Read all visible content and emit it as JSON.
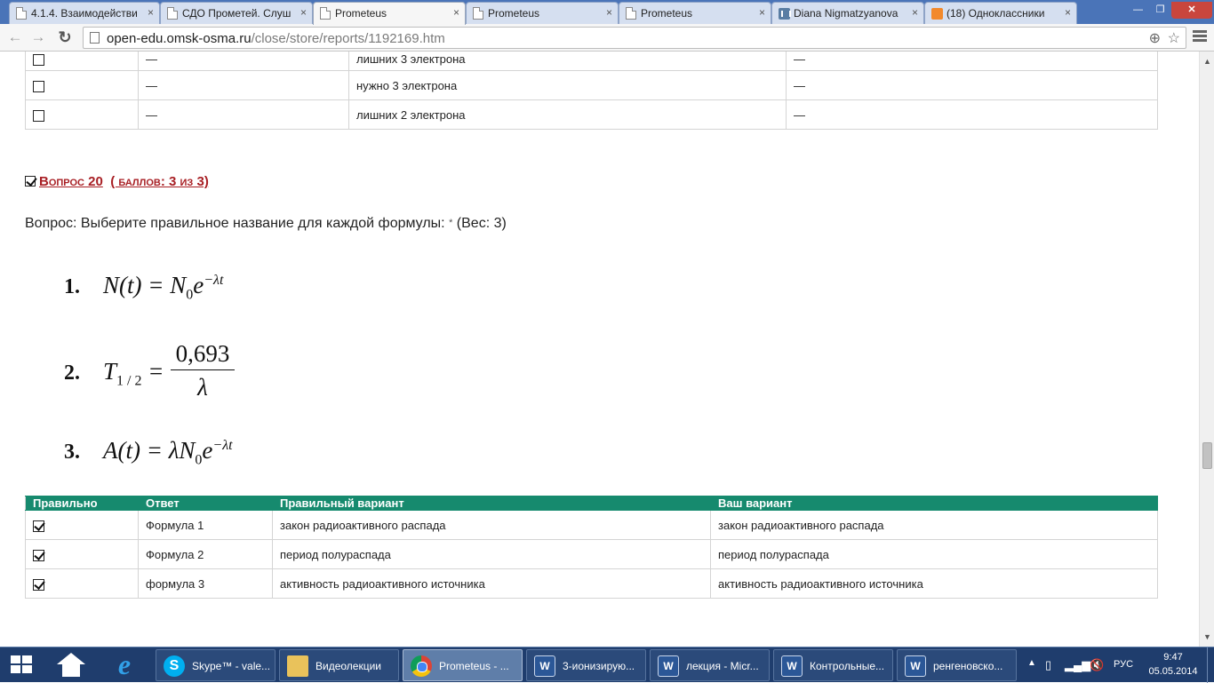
{
  "browser": {
    "tabs": [
      {
        "title": "4.1.4. Взаимодействи",
        "icon": "page-icon"
      },
      {
        "title": "СДО Прометей. Слуш",
        "icon": "page-icon"
      },
      {
        "title": "Prometeus",
        "icon": "page-icon",
        "active": true
      },
      {
        "title": "Prometeus",
        "icon": "page-icon"
      },
      {
        "title": "Prometeus",
        "icon": "page-icon"
      },
      {
        "title": "Diana Nigmatzyanova",
        "icon": "vk-icon"
      },
      {
        "title": "(18) Одноклассники",
        "icon": "odnoklassniki-icon"
      }
    ],
    "tab_close": "×",
    "window_controls": {
      "minimize": "—",
      "maximize": "❐",
      "close": "✕"
    },
    "url_host": "open-edu.omsk-osma.ru",
    "url_path": "/close/store/reports/1192169.htm"
  },
  "prev_table": {
    "rows": [
      {
        "checked": false,
        "c2": "—",
        "c3": "лишних 3 электрона",
        "c4": "—"
      },
      {
        "checked": false,
        "c2": "—",
        "c3": "нужно 3 электрона",
        "c4": "—"
      },
      {
        "checked": false,
        "c2": "—",
        "c3": "лишних 2 электрона",
        "c4": "—"
      }
    ]
  },
  "question": {
    "label": "Вопрос 20",
    "score": "( баллов: 3 из 3)",
    "text": "Вопрос: Выберите правильное название для каждой формулы:",
    "required_mark": "*",
    "weight": "(Вес: 3)"
  },
  "formulas": {
    "f1_num": "1.",
    "f2_num": "2.",
    "f3_num": "3.",
    "f2_numerator": "0,693",
    "f2_denominator": "λ"
  },
  "answers_table": {
    "headers": [
      "Правильно",
      "Ответ",
      "Правильный вариант",
      "Ваш вариант"
    ],
    "rows": [
      {
        "correct": true,
        "answer": "Формула 1",
        "correct_option": "закон радиоактивного распада",
        "your_option": "закон радиоактивного распада"
      },
      {
        "correct": true,
        "answer": "Формула 2",
        "correct_option": "период полураспада",
        "your_option": "период полураспада"
      },
      {
        "correct": true,
        "answer": "формула 3",
        "correct_option": "активность радиоактивного источника",
        "your_option": "активность радиоактивного источника"
      }
    ]
  },
  "taskbar": {
    "tasks": [
      {
        "label": "Skype™ - vale...",
        "icon": "skype-icon"
      },
      {
        "label": "Видеолекции",
        "icon": "folder-icon"
      },
      {
        "label": "Prometeus - ...",
        "icon": "chrome-icon",
        "active": true
      },
      {
        "label": "3-ионизирую...",
        "icon": "word-icon"
      },
      {
        "label": "лекция - Micr...",
        "icon": "word-icon"
      },
      {
        "label": "Контрольные...",
        "icon": "word-icon"
      },
      {
        "label": "ренгеновско...",
        "icon": "word-icon"
      }
    ],
    "language": "РУС",
    "time": "9:47",
    "date": "05.05.2014"
  },
  "colors": {
    "table_header": "#168a6e",
    "question_heading": "#a81f24",
    "tab_strip": "#4a74b8",
    "taskbar": "#1f3d6d"
  }
}
